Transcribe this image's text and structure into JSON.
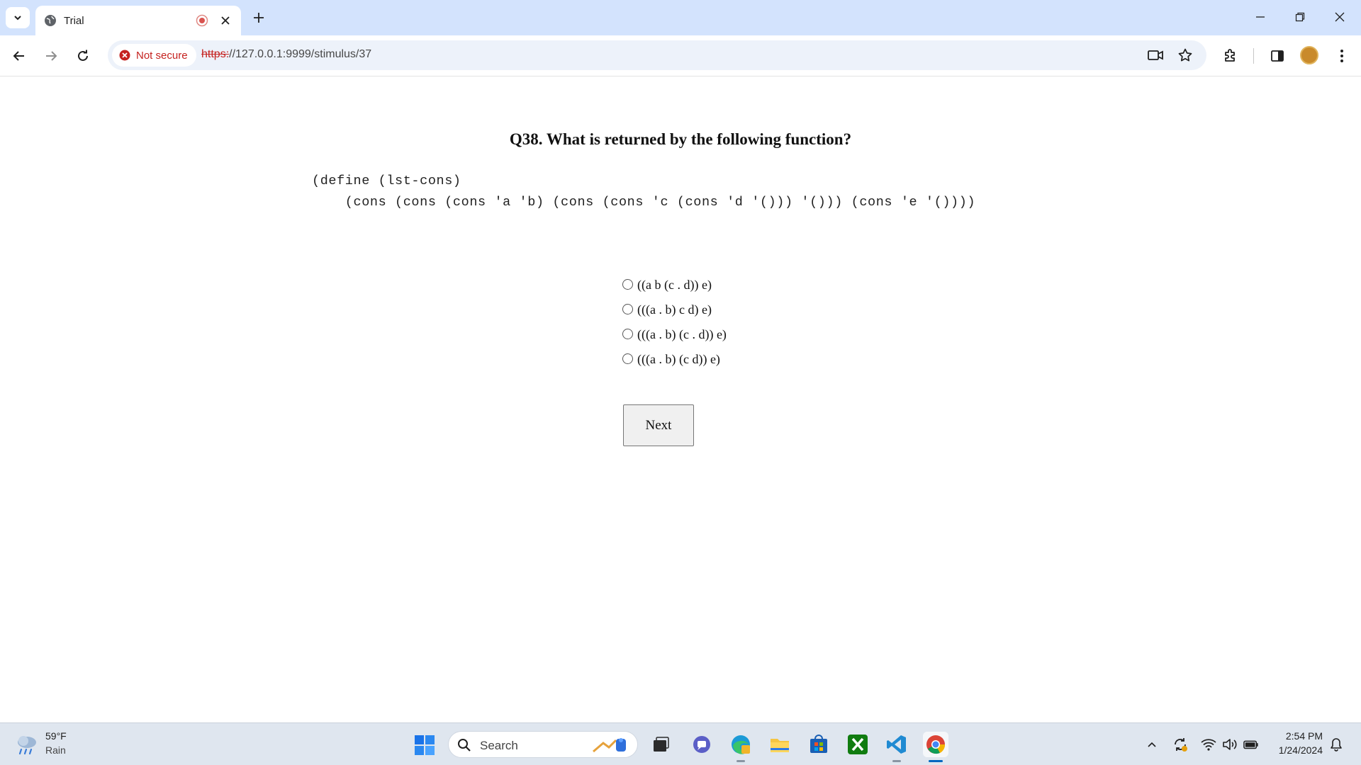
{
  "browser": {
    "tab": {
      "title": "Trial"
    },
    "address_bar": {
      "security_label": "Not secure",
      "url_scheme": "https:",
      "url_rest": "//127.0.0.1:9999/stimulus/37"
    }
  },
  "page": {
    "question": "Q38. What is returned by the following function?",
    "code_lines": [
      "(define (lst-cons)",
      "    (cons (cons (cons 'a 'b) (cons (cons 'c (cons 'd '())) '())) (cons 'e '())))"
    ],
    "options": [
      "((a b (c . d)) e)",
      "(((a . b) c d) e)",
      "(((a . b) (c . d)) e)",
      "(((a . b) (c d)) e)"
    ],
    "next_label": "Next"
  },
  "taskbar": {
    "weather": {
      "temp": "59°F",
      "condition": "Rain"
    },
    "search_placeholder": "Search",
    "clock": {
      "time": "2:54 PM",
      "date": "1/24/2024"
    }
  }
}
